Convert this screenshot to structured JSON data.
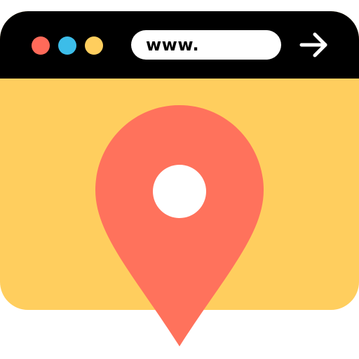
{
  "browser": {
    "titlebar_color": "#000000",
    "content_color": "#ffce5e",
    "window_controls": [
      {
        "name": "close",
        "color": "#ff6a59"
      },
      {
        "name": "minimize",
        "color": "#3cbde9"
      },
      {
        "name": "maximize",
        "color": "#ffce5e"
      }
    ],
    "address_bar": {
      "value": "www."
    },
    "go_button": {
      "icon": "arrow-right-icon"
    }
  },
  "content": {
    "icon": "map-pin-icon",
    "pin_color": "#ff725c",
    "pin_hole_color": "#ffffff"
  }
}
